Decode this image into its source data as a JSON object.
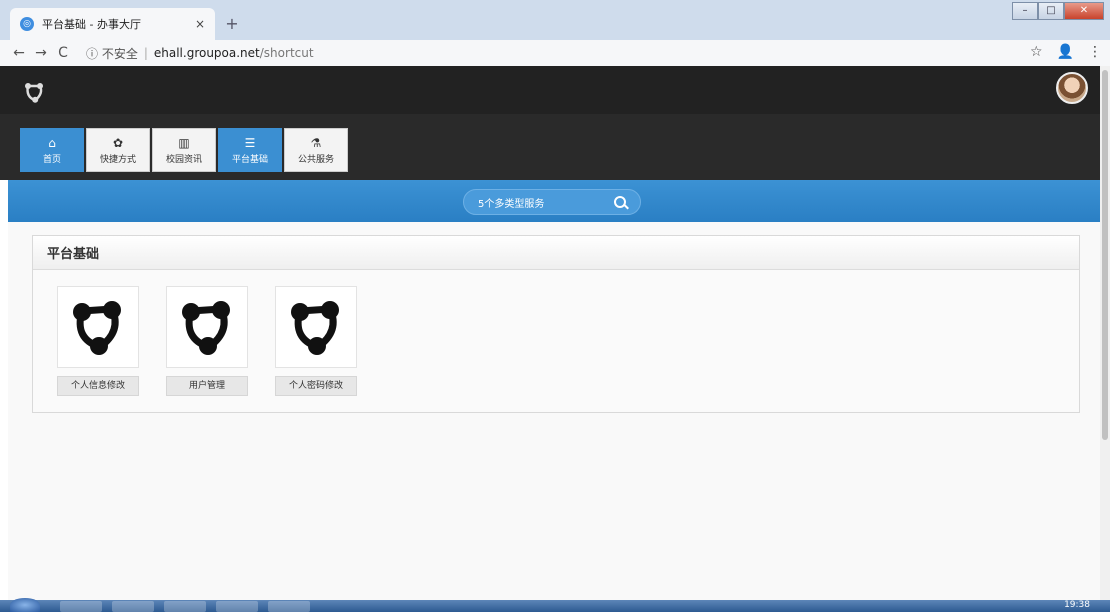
{
  "browser": {
    "tab_title": "平台基础 - 办事大厅",
    "tab_close": "×",
    "new_tab": "+",
    "win_minimize": "–",
    "win_maximize": "□",
    "win_close": "✕",
    "back": "←",
    "forward": "→",
    "reload": "C",
    "insecure_label": "ⓘ 不安全",
    "url_host": "ehall.groupoa.net",
    "url_path": "/shortcut",
    "star": "☆",
    "profile": "👤",
    "menu": "⋮"
  },
  "nav": {
    "tiles": [
      {
        "label": "首页",
        "icon": "home-icon",
        "glyph": "⌂",
        "active": true
      },
      {
        "label": "快捷方式",
        "icon": "palette-icon",
        "glyph": "✿",
        "active": false
      },
      {
        "label": "校园资讯",
        "icon": "chart-icon",
        "glyph": "▥",
        "active": false
      },
      {
        "label": "平台基础",
        "icon": "list-icon",
        "glyph": "☰",
        "active": true
      },
      {
        "label": "公共服务",
        "icon": "flask-icon",
        "glyph": "⚗",
        "active": false
      }
    ]
  },
  "search": {
    "placeholder": "5个多类型服务"
  },
  "panel": {
    "title": "平台基础",
    "apps": [
      {
        "label": "个人信息修改",
        "icon": "app-logo-icon"
      },
      {
        "label": "用户管理",
        "icon": "app-logo-icon"
      },
      {
        "label": "个人密码修改",
        "icon": "app-logo-icon"
      }
    ]
  },
  "taskbar": {
    "clock": "19:38"
  },
  "colors": {
    "accent": "#3b8fd2",
    "header_bg": "#222222",
    "band_bg": "#2a2a2a"
  }
}
